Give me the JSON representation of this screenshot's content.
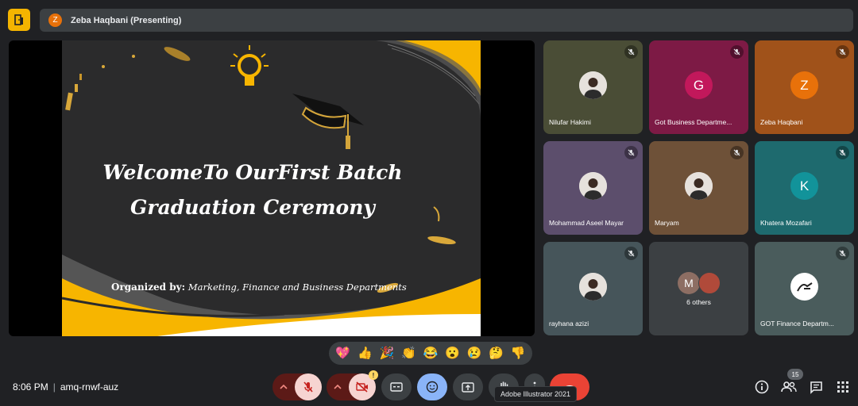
{
  "presenter": {
    "initial": "Z",
    "label": "Zeba Haqbani (Presenting)"
  },
  "slide": {
    "title_line1": "WelcomeTo OurFirst Batch",
    "title_line2": "Graduation Ceremony",
    "organized_label": "Organized by:",
    "organized_value": "Marketing, Finance and Business Departments"
  },
  "participants": [
    {
      "name": "Nilufar Hakimi",
      "type": "photo",
      "bg": "#4a4d36"
    },
    {
      "name": "Got Business Departme...",
      "type": "initial",
      "initial": "G",
      "bg": "#7d1a45",
      "avatar_color": "#c2185b"
    },
    {
      "name": "Zeba Haqbani",
      "type": "initial",
      "initial": "Z",
      "bg": "#a0521a",
      "avatar_color": "#e8710a"
    },
    {
      "name": "Mohammad Aseel Mayar",
      "type": "photo",
      "bg": "#5c4e6c"
    },
    {
      "name": "Maryam",
      "type": "photo",
      "bg": "#6e5138"
    },
    {
      "name": "Khatera Mozafari",
      "type": "initial",
      "initial": "K",
      "bg": "#1e6a6e",
      "avatar_color": "#12939a"
    },
    {
      "name": "rayhana azizi",
      "type": "photo",
      "bg": "#46555a"
    },
    {
      "name": "6 others",
      "type": "others",
      "initial": "M",
      "bg": "#3c4043"
    },
    {
      "name": "GOT Finance Departm...",
      "type": "logo",
      "bg": "#4a5c5c"
    }
  ],
  "reactions": [
    "💖",
    "👍",
    "🎉",
    "👏",
    "😂",
    "😮",
    "😢",
    "🤔",
    "👎"
  ],
  "meeting": {
    "time": "8:06 PM",
    "code": "amq-rnwf-auz"
  },
  "camera_badge": "!",
  "tooltip": "Adobe Illustrator 2021",
  "people_count": "15",
  "colors": {
    "accent": "#f4b400",
    "danger": "#ea4335",
    "muted_btn": "#f6d4d1"
  }
}
